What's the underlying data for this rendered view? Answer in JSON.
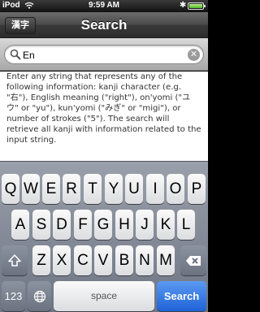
{
  "status_bar": {
    "carrier": "iPod",
    "time": "9:59 AM",
    "bluetooth_glyph": "✱"
  },
  "nav_bar": {
    "back_label": "漢字",
    "title": "Search"
  },
  "search": {
    "value": "En",
    "placeholder": "",
    "clear_glyph": "✕"
  },
  "help_text": "Enter any string that represents any of the following information: kanji character (e.g. \"右\"), English meaning (\"right\"), on'yomi (\"ユウ\" or \"yu\"), kun'yomi (\"みぎ\" or \"migi\"), or number of strokes (\"5\"). The search will retrieve all kanji with information related to the input string.",
  "keyboard": {
    "row1": [
      "Q",
      "W",
      "E",
      "R",
      "T",
      "Y",
      "U",
      "I",
      "O",
      "P"
    ],
    "row2": [
      "A",
      "S",
      "D",
      "F",
      "G",
      "H",
      "J",
      "K",
      "L"
    ],
    "row3": [
      "Z",
      "X",
      "C",
      "V",
      "B",
      "N",
      "M"
    ],
    "numbers_label": "123",
    "space_label": "space",
    "search_label": "Search"
  },
  "colors": {
    "search_key": "#2a6fe0",
    "battery_fill": "#5cc22a"
  },
  "icons": {
    "wifi": "wifi-icon",
    "bluetooth": "bluetooth-icon",
    "battery": "battery-icon",
    "magnifier": "search-icon",
    "clear": "clear-icon",
    "shift": "shift-icon",
    "backspace": "backspace-icon",
    "globe": "globe-icon"
  }
}
